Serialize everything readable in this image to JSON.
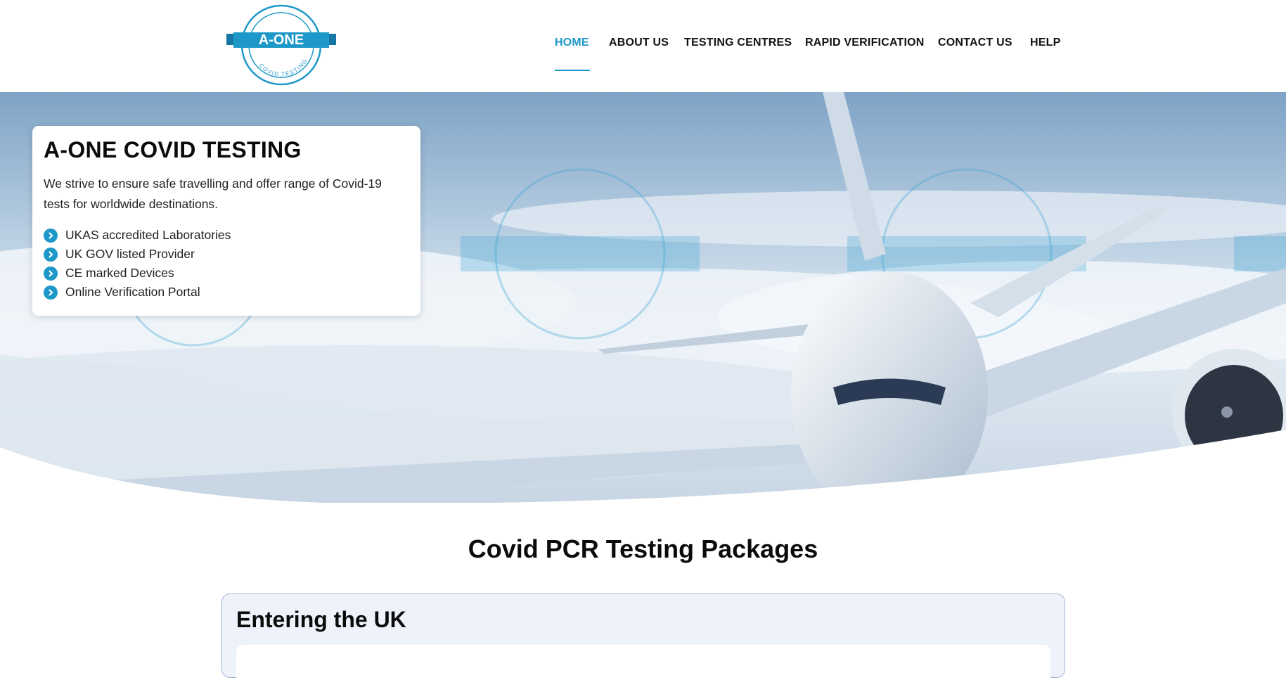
{
  "header": {
    "logo": {
      "brand_text": "A-ONE",
      "tagline": "COVID TESTING",
      "icon": "a-one-covid-testing-logo"
    },
    "nav": [
      {
        "label": "HOME",
        "active": true
      },
      {
        "label": "ABOUT US",
        "active": false
      },
      {
        "label": "TESTING CENTRES",
        "active": false
      },
      {
        "label": "RAPID VERIFICATION",
        "active": false
      },
      {
        "label": "CONTACT US",
        "active": false
      },
      {
        "label": "HELP",
        "active": false
      }
    ]
  },
  "hero": {
    "title": "A-ONE COVID TESTING",
    "description": "We strive to ensure safe travelling and offer range of Covid-19 tests for worldwide destinations.",
    "features": [
      "UKAS accredited Laboratories",
      "UK GOV listed Provider",
      "CE marked Devices",
      "Online Verification Portal"
    ],
    "feature_icon": "chevron-right-circle-icon",
    "background": "airplane-above-clouds-image"
  },
  "packages": {
    "section_title": "Covid PCR Testing Packages",
    "first_group_title": "Entering the UK"
  },
  "colors": {
    "accent": "#1e98c9",
    "text": "#111111",
    "package_bg": "#eef3fb",
    "package_border": "#a7b4d6"
  }
}
